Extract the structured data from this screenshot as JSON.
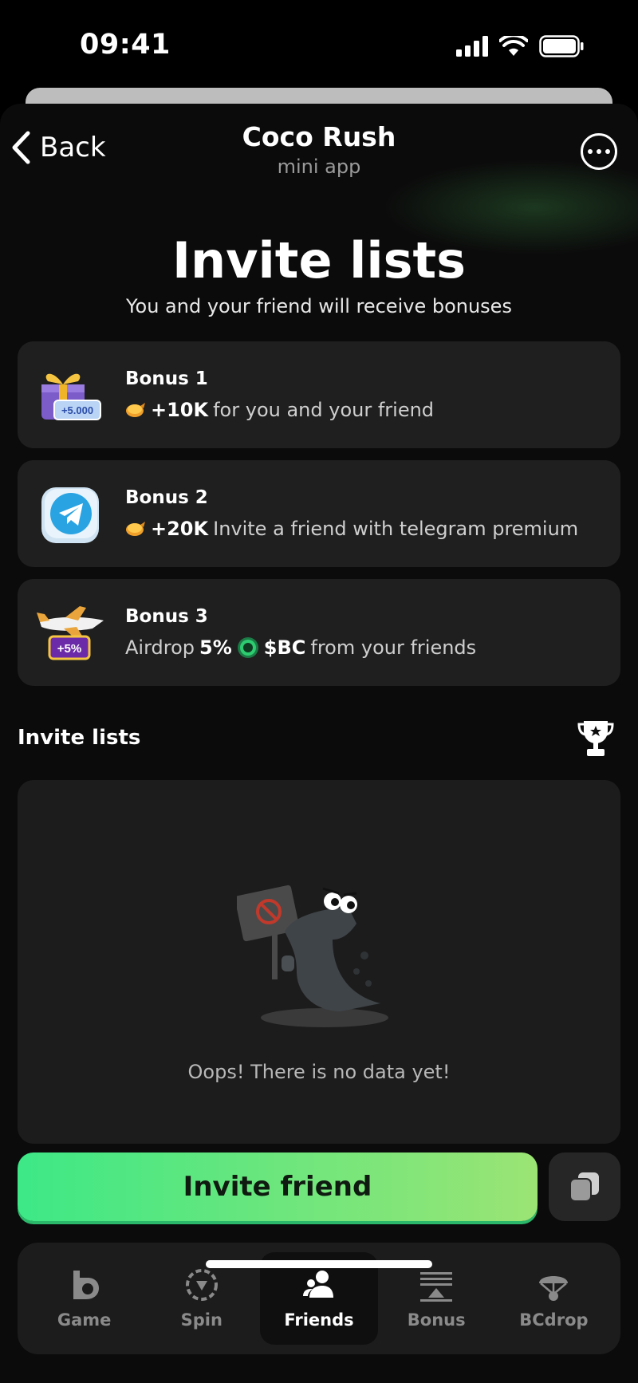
{
  "status_bar": {
    "time": "09:41"
  },
  "header": {
    "back_label": "Back",
    "title": "Coco Rush",
    "subtitle": "mini app"
  },
  "hero": {
    "title": "Invite lists",
    "subtitle": "You and your friend will receive bonuses"
  },
  "bonuses": [
    {
      "title": "Bonus 1",
      "amount": "+10K",
      "text": "for you and your friend",
      "badge": "+5.000"
    },
    {
      "title": "Bonus 2",
      "amount": "+20K",
      "text": "Invite a friend with telegram premium"
    },
    {
      "title": "Bonus 3",
      "prefix": "Airdrop",
      "percent": "5%",
      "token": "$BC",
      "text": "from your friends",
      "badge": "+5%"
    }
  ],
  "invite_section": {
    "label": "Invite lists",
    "empty_text": "Oops! There is no data yet!"
  },
  "actions": {
    "invite_label": "Invite friend"
  },
  "nav": {
    "items": [
      {
        "label": "Game",
        "icon": "game-icon"
      },
      {
        "label": "Spin",
        "icon": "spin-icon"
      },
      {
        "label": "Friends",
        "icon": "friends-icon",
        "active": true
      },
      {
        "label": "Bonus",
        "icon": "bonus-icon"
      },
      {
        "label": "BCdrop",
        "icon": "bcdrop-icon"
      }
    ]
  },
  "colors": {
    "accent_start": "#3de886",
    "accent_end": "#9be474",
    "card_bg": "#1f1f1f",
    "app_bg": "#0b0b0b"
  }
}
